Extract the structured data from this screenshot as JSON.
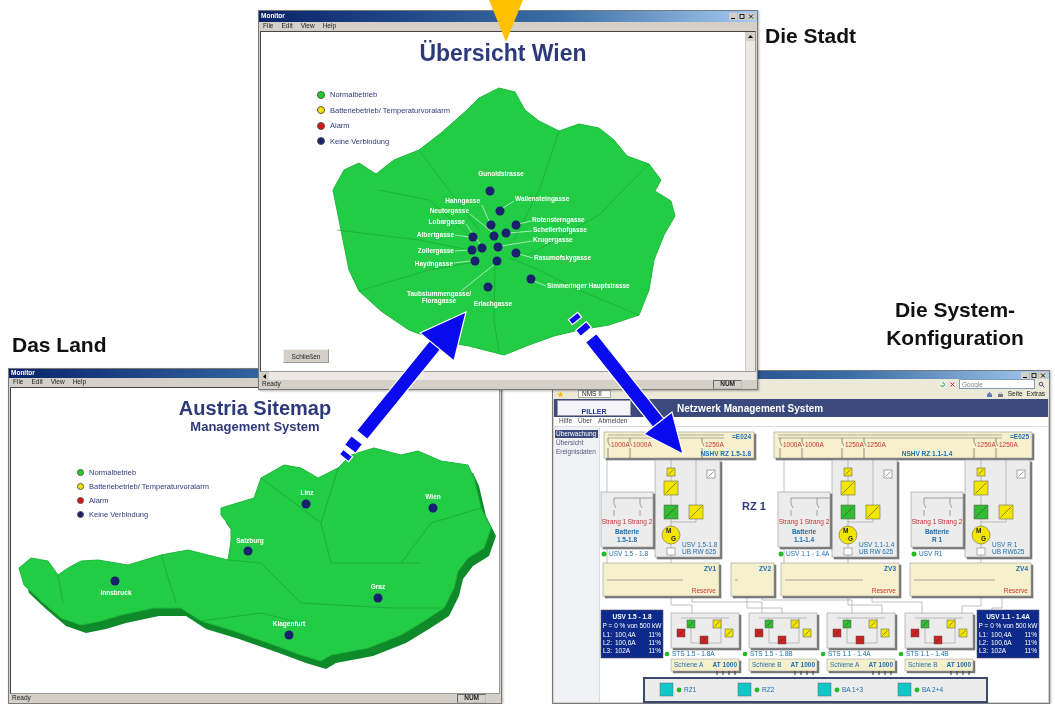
{
  "city_caption": "Die Stadt",
  "country_caption": "Das Land",
  "system_caption": "Die System-Konfiguration",
  "vienna_window": {
    "title": "Monitor",
    "menu": [
      "File",
      "Edit",
      "View",
      "Help"
    ],
    "heading": "Übersicht Wien",
    "legend": [
      {
        "label": "Normalbetrieb",
        "color": "#22cc22"
      },
      {
        "label": "Batteriebetrieb/ Temperaturvoralarm",
        "color": "#f2e600"
      },
      {
        "label": "Alarm",
        "color": "#dd1111"
      },
      {
        "label": "Keine Verbindung",
        "color": "#1a1f6e"
      }
    ],
    "sites": [
      {
        "label_lines": [
          "Gunoldstrasse"
        ]
      },
      {
        "label_lines": [
          "Hahngasse"
        ]
      },
      {
        "label_lines": [
          "Wallensteingasse"
        ]
      },
      {
        "label_lines": [
          "Neutorgasse"
        ]
      },
      {
        "label_lines": [
          "Lobargasse"
        ]
      },
      {
        "label_lines": [
          "Rotensterngasse"
        ]
      },
      {
        "label_lines": [
          "Schellerhofgasse"
        ]
      },
      {
        "label_lines": [
          "Albertgasse"
        ]
      },
      {
        "label_lines": [
          "Krugergasse"
        ]
      },
      {
        "label_lines": [
          "Zollergasse"
        ]
      },
      {
        "label_lines": [
          "Rasumofskygasse"
        ]
      },
      {
        "label_lines": [
          "Haydngasse"
        ]
      },
      {
        "label_lines": [
          "Simmeringer Hauptstrasse"
        ]
      },
      {
        "label_lines": [
          "Taubstummengasse/",
          "Floragasse"
        ]
      },
      {
        "label_lines": [
          "Erlachgasse"
        ]
      }
    ],
    "close_button": "Schließen",
    "status": "Ready",
    "status_indicator": "NUM"
  },
  "austria_window": {
    "title": "Monitor",
    "menu": [
      "File",
      "Edit",
      "View",
      "Help"
    ],
    "heading": "Austria Sitemap",
    "subheading": "Management System",
    "legend": [
      {
        "label": "Normalbetrieb",
        "color": "#22cc22"
      },
      {
        "label": "Batteriebetrieb/ Temperaturvoralarm",
        "color": "#f2e600"
      },
      {
        "label": "Alarm",
        "color": "#dd1111"
      },
      {
        "label": "Keine Verbindung",
        "color": "#1a1f6e"
      }
    ],
    "cities": [
      {
        "label": "Linz"
      },
      {
        "label": "Wien"
      },
      {
        "label": "Salzburg"
      },
      {
        "label": "Innsbruck"
      },
      {
        "label": "Graz"
      },
      {
        "label": "Klagenfurt"
      }
    ],
    "status": "Ready",
    "status_indicator": "NUM"
  },
  "network_window": {
    "search_placeholder": "Google",
    "tab": "NMS II",
    "toolbar": [
      "Seite",
      "Extras"
    ],
    "logo": "PILLER",
    "header": "Netzwerk Management System",
    "nav": [
      "Hilfe",
      "Über",
      "Abmelden"
    ],
    "sidebar": [
      {
        "label": "Überwachung",
        "selected": true
      },
      {
        "label": "Übersicht",
        "selected": false
      },
      {
        "label": "Ereignisdaten",
        "selected": false
      }
    ],
    "section_label": "RZ 1",
    "switchboards": [
      {
        "code": "=E024",
        "name": "NSHV RZ 1.5-1.8",
        "breakers": [
          "1000A",
          "1000A",
          "1250A"
        ]
      },
      {
        "code": "=E025",
        "name": "NSHV RZ 1.1-1.4",
        "breakers": [
          "1000A",
          "1000A",
          "1250A",
          "1250A",
          "1250A",
          "1250A"
        ]
      }
    ],
    "ups_units": [
      {
        "name_lines": [
          "USV 1.5-1.8",
          "UB RW 625"
        ],
        "machine": [
          "M",
          "G"
        ],
        "strings": [
          "Strang 1",
          "Strang 2"
        ],
        "battery": [
          "Batterie",
          "1.5-1.8"
        ],
        "status": "USV 1.5 - 1.8"
      },
      {
        "name_lines": [
          "USV 1.1-1.4",
          "UB RW 625"
        ],
        "machine": [
          "M",
          "G"
        ],
        "strings": [
          "Strang 1",
          "Strang 2"
        ],
        "battery": [
          "Batterie",
          "1.1-1.4"
        ],
        "status": "USV 1.1 - 1.4A"
      },
      {
        "name_lines": [
          "USV R 1",
          "UB RW625"
        ],
        "machine": [
          "M",
          "G"
        ],
        "strings": [
          "Strang 1",
          "Strang 2"
        ],
        "battery": [
          "Batterie",
          "R 1"
        ],
        "status": "USV R1"
      }
    ],
    "distributors": [
      {
        "name": "ZV1",
        "reserve": "Reserve"
      },
      {
        "name": "ZV2"
      },
      {
        "name": "ZV3",
        "reserve": "Reserve"
      },
      {
        "name": "ZV4",
        "reserve": "Reserve"
      }
    ],
    "sts_units": [
      {
        "name": "STS 1.5 - 1.8A",
        "rating": "AT 1000",
        "rail": "Schiene A"
      },
      {
        "name": "STS 1.5 - 1.8B",
        "rating": "AT 1000",
        "rail": "Schiene B"
      },
      {
        "name": "STS 1.1 - 1.4A",
        "rating": "AT 1000",
        "rail": "Schiene A"
      },
      {
        "name": "STS 1.1 - 1.4B",
        "rating": "AT 1000",
        "rail": "Schiene B"
      }
    ],
    "power_panels": [
      {
        "title": "USV 1.5 - 1.8",
        "load": "P = 0 % von 500 kW",
        "phases": [
          {
            "phase": "L1:",
            "current": "100,4A",
            "share": "11%"
          },
          {
            "phase": "L2:",
            "current": "100,6A",
            "share": "11%"
          },
          {
            "phase": "L3:",
            "current": "102A",
            "share": "11%"
          }
        ]
      },
      {
        "title": "USV 1.1 - 1.4A",
        "load": "P = 0 % von 500 kW",
        "phases": [
          {
            "phase": "L1:",
            "current": "100,4A",
            "share": "11%"
          },
          {
            "phase": "L2:",
            "current": "100,6A",
            "share": "11%"
          },
          {
            "phase": "L3:",
            "current": "102A",
            "share": "11%"
          }
        ]
      }
    ],
    "outputs": [
      {
        "label": "RZ1"
      },
      {
        "label": "RZ2"
      },
      {
        "label": "BA 1+3"
      },
      {
        "label": "BA 2+4"
      }
    ]
  }
}
